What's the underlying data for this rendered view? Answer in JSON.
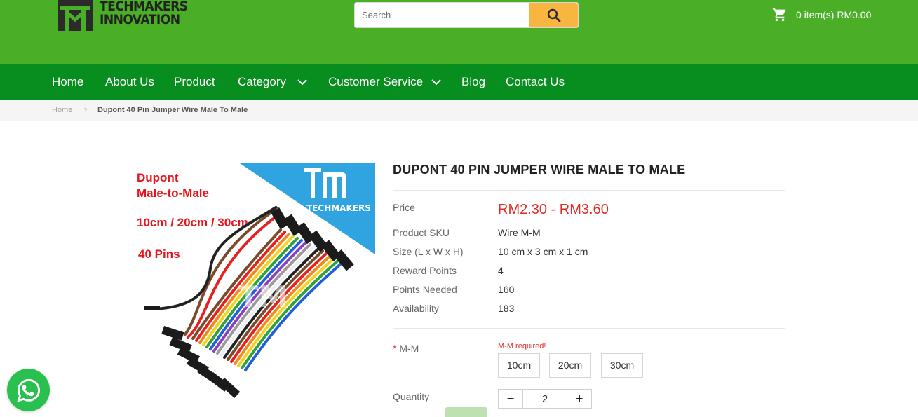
{
  "header": {
    "logo_line1": "TECHMAKERS",
    "logo_line2": "INNOVATION",
    "search_placeholder": "Search",
    "cart_text": "0 item(s) RM0.00"
  },
  "nav": {
    "items": [
      "Home",
      "About Us",
      "Product",
      "Category",
      "Customer Service",
      "Blog",
      "Contact Us"
    ]
  },
  "breadcrumb": {
    "home": "Home",
    "separator": "›",
    "current": "Dupont 40 Pin Jumper Wire Male To Male"
  },
  "product_image": {
    "brand": "TECHMAKERS",
    "line1": "Dupont",
    "line2": "Male-to-Male",
    "line3": "10cm / 20cm / 30cm",
    "line4": "40 Pins",
    "watermark": "TM"
  },
  "product": {
    "title": "DUPONT 40 PIN JUMPER WIRE MALE TO MALE",
    "price_label": "Price",
    "price": "RM2.30 - RM3.60",
    "specs": [
      {
        "label": "Product SKU",
        "value": "Wire M-M"
      },
      {
        "label": "Size (L x W x H)",
        "value": "10 cm x 3 cm x 1 cm"
      },
      {
        "label": "Reward Points",
        "value": "4"
      },
      {
        "label": "Points Needed",
        "value": "160"
      },
      {
        "label": "Availability",
        "value": "183"
      }
    ],
    "option": {
      "required_mark": "*",
      "label": "M-M",
      "error": "M-M required!",
      "choices": [
        "10cm",
        "20cm",
        "30cm"
      ]
    },
    "quantity_label": "Quantity",
    "quantity": "2",
    "minus": "−",
    "plus": "+"
  },
  "colors": {
    "header_green": "#4aae27",
    "nav_green": "#078e1e",
    "search_button": "#f8b53f",
    "price_red": "#e02b27",
    "whatsapp_green": "#29c04f"
  },
  "icons": {
    "search": "search-icon",
    "cart": "cart-icon",
    "chevron": "chevron-down-icon",
    "whatsapp": "whatsapp-icon"
  }
}
